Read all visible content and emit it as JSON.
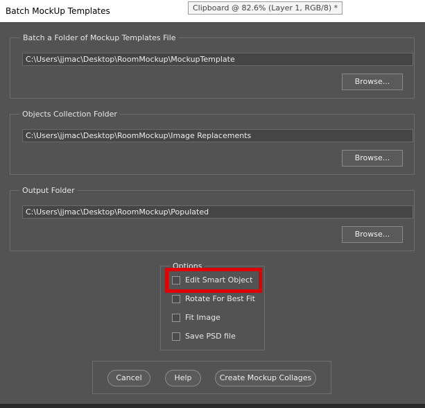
{
  "window": {
    "title": "Batch MockUp Templates"
  },
  "tooltip": {
    "text": "Clipboard @ 82.6% (Layer 1, RGB/8) *"
  },
  "templates_group": {
    "label": "Batch a Folder of Mockup Templates File",
    "path": "C:\\Users\\jjmac\\Desktop\\RoomMockup\\MockupTemplate",
    "browse_label": "Browse..."
  },
  "objects_group": {
    "label": "Objects Collection Folder",
    "path": "C:\\Users\\jjmac\\Desktop\\RoomMockup\\Image Replacements",
    "browse_label": "Browse..."
  },
  "output_group": {
    "label": "Output Folder",
    "path": "C:\\Users\\jjmac\\Desktop\\RoomMockup\\Populated",
    "browse_label": "Browse..."
  },
  "options": {
    "label": "Options",
    "items": [
      {
        "label": "Edit Smart Object",
        "checked": false
      },
      {
        "label": "Rotate For Best Fit",
        "checked": false
      },
      {
        "label": "Fit Image",
        "checked": false
      },
      {
        "label": "Save PSD file",
        "checked": false
      }
    ]
  },
  "buttons": {
    "cancel": "Cancel",
    "help": "Help",
    "create": "Create Mockup Collages"
  },
  "colors": {
    "dialog_bg": "#535353",
    "highlight": "#e10000"
  }
}
